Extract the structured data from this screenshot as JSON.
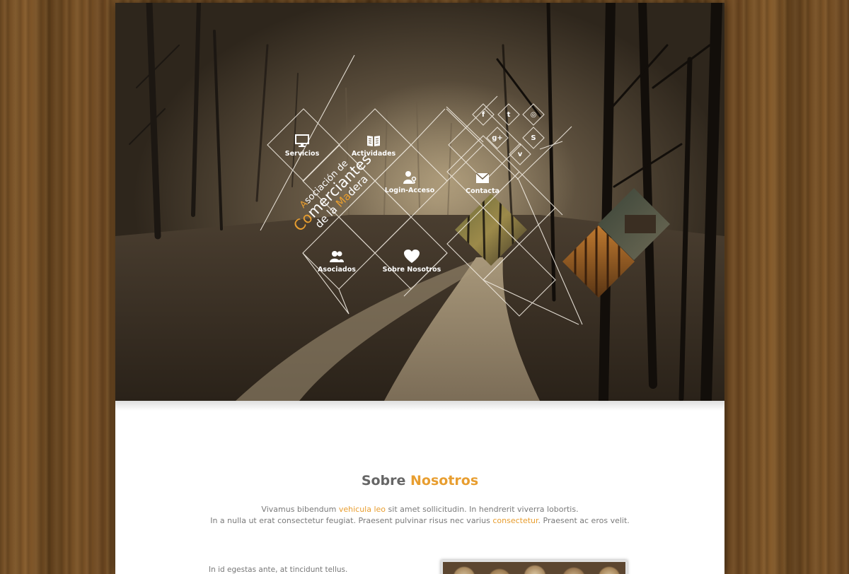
{
  "hero": {
    "logo": {
      "line1_first": "A",
      "line1_rest": "sociación de",
      "line2_first": "Co",
      "line2_rest": "merciantes",
      "line3_first": "de la ",
      "line3_accent": "Ma",
      "line3_rest": "dera"
    },
    "menu": [
      {
        "key": "servicios",
        "label": "Servicios",
        "icon": "monitor-icon"
      },
      {
        "key": "actividades",
        "label": "Actividades",
        "icon": "book-icon"
      },
      {
        "key": "login",
        "label": "Login-Acceso",
        "icon": "users-key-icon"
      },
      {
        "key": "contacta",
        "label": "Contacta",
        "icon": "envelope-icon"
      },
      {
        "key": "asociados",
        "label": "Asociados",
        "icon": "people-icon"
      },
      {
        "key": "sobre",
        "label": "Sobre Nosotros",
        "icon": "heart-icon"
      }
    ],
    "social": [
      {
        "key": "facebook",
        "glyph": "f",
        "icon": "facebook-icon"
      },
      {
        "key": "twitter",
        "glyph": "t",
        "icon": "twitter-icon"
      },
      {
        "key": "dribbble",
        "glyph": "◎",
        "icon": "dribbble-icon"
      },
      {
        "key": "googleplus",
        "glyph": "g+",
        "icon": "google-plus-icon"
      },
      {
        "key": "skype",
        "glyph": "S",
        "icon": "skype-icon"
      },
      {
        "key": "vimeo",
        "glyph": "v",
        "icon": "vimeo-icon"
      }
    ]
  },
  "about": {
    "title_plain": "Sobre ",
    "title_accent": "Nosotros",
    "p1_a": "Vivamus bibendum ",
    "p1_link": "vehicula leo",
    "p1_b": " sit amet sollicitudin. In hendrerit viverra lobortis.",
    "p2_a": "In a nulla ut erat consectetur feugiat. Praesent pulvinar risus nec varius ",
    "p2_link": "consectetur",
    "p2_b": ". Praesent ac eros velit.",
    "column_text": "In id egestas ante, at tincidunt tellus."
  },
  "colors": {
    "accent": "#e89e30",
    "wood": "#6e4a22",
    "white": "#ffffff"
  }
}
